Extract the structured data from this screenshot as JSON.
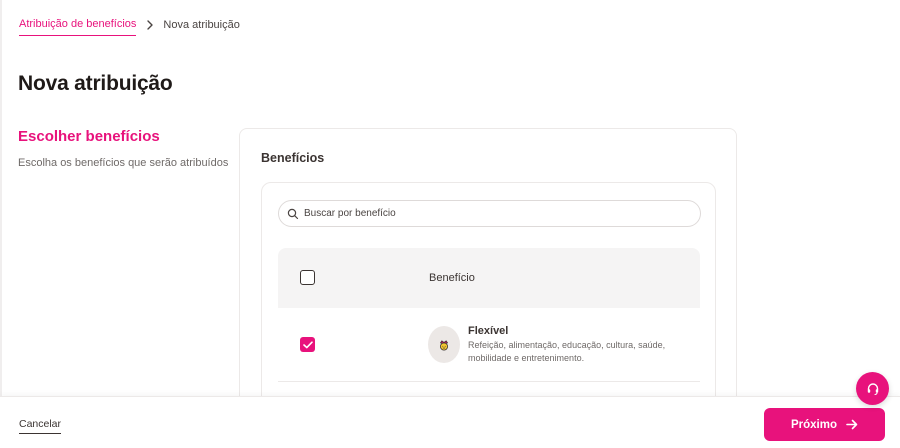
{
  "breadcrumb": {
    "parent": "Atribuição de benefícios",
    "current": "Nova atribuição"
  },
  "page": {
    "title": "Nova atribuição"
  },
  "step": {
    "title": "Escolher benefícios",
    "description": "Escolha os benefícios que serão atribuídos"
  },
  "benefits_card": {
    "title": "Benefícios",
    "search_placeholder": "Buscar por benefício",
    "column_header": "Benefício",
    "rows": [
      {
        "name": "Flexível",
        "description": "Refeição, alimentação, educação, cultura, saúde, mobilidade e entretenimento.",
        "checked": true,
        "icon": "crown-icon"
      }
    ]
  },
  "footer": {
    "cancel_label": "Cancelar",
    "next_label": "Próximo"
  },
  "colors": {
    "accent": "#e8127c",
    "text": "#3b3432"
  }
}
